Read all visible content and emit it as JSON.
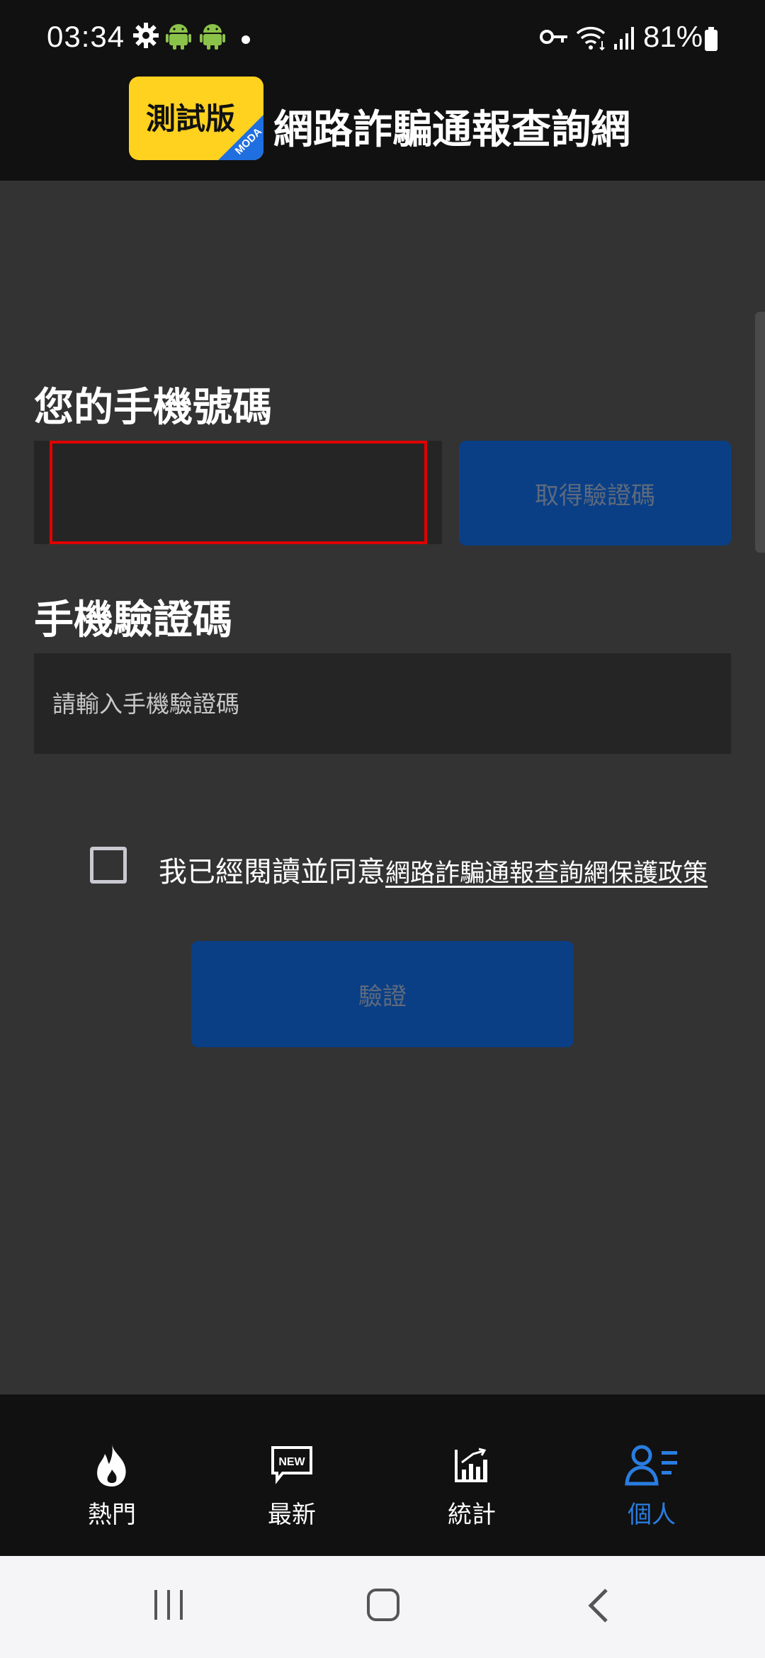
{
  "status_bar": {
    "time": "03:34",
    "battery": "81%",
    "icons": [
      "settings-icon",
      "android-icon",
      "android-icon",
      "notification-dot-icon",
      "vpn-key-icon",
      "wifi-icon",
      "signal-icon",
      "battery-icon"
    ]
  },
  "header": {
    "logo_text": "測試版",
    "logo_badge": "MODA",
    "title": "網路詐騙通報查詢網"
  },
  "form": {
    "phone_label": "您的手機號碼",
    "phone_value": "",
    "get_code_label": "取得驗證碼",
    "code_label": "手機驗證碼",
    "code_placeholder": "請輸入手機驗證碼",
    "agree_text": "我已經閱讀並同意",
    "agree_link": "網路詐騙通報查詢網保護政策",
    "checkbox_checked": false,
    "verify_label": "驗證"
  },
  "bottom_nav": {
    "items": [
      {
        "label": "熱門",
        "icon": "fire-icon",
        "active": false
      },
      {
        "label": "最新",
        "icon": "new-icon",
        "active": false
      },
      {
        "label": "統計",
        "icon": "stats-icon",
        "active": false
      },
      {
        "label": "個人",
        "icon": "person-icon",
        "active": true
      }
    ],
    "new_badge": "NEW"
  },
  "colors": {
    "background": "#333333",
    "bar": "#111111",
    "button": "#0a3f86",
    "active": "#2a7de1",
    "logo_yellow": "#ffd21f",
    "highlight_red": "#e00000"
  }
}
